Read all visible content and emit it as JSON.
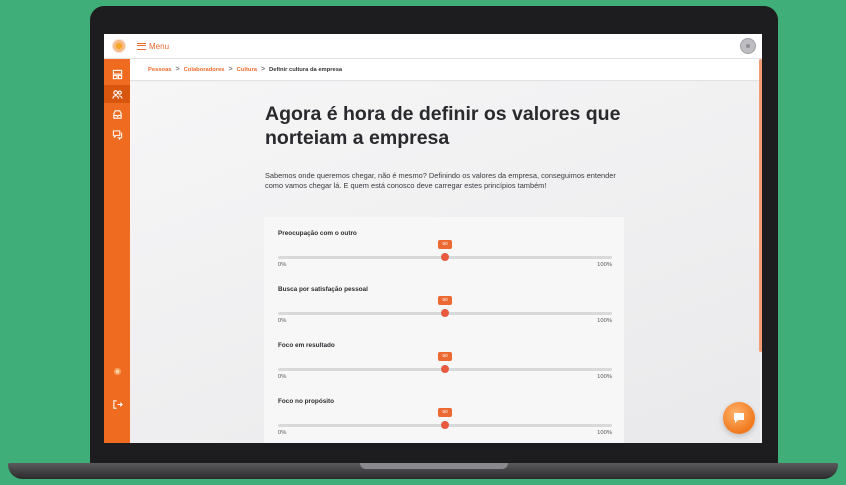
{
  "app": {
    "menu_label": "Menu"
  },
  "breadcrumb": {
    "items": [
      "Pessoas",
      "Colaboradores",
      "Cultura"
    ],
    "current": "Definir cultura da empresa",
    "separator": ">"
  },
  "page": {
    "heading": "Agora é hora de definir os valores que norteiam a empresa",
    "intro": "Sabemos onde queremos chegar, não é mesmo? Definindo os valores da empresa, conseguimos entender como vamos chegar lá. E quem está conosco deve carregar estes princípios também!"
  },
  "sliders": [
    {
      "label": "Preocupação com o outro",
      "value": 50,
      "min_label": "0%",
      "max_label": "100%"
    },
    {
      "label": "Busca por satisfação pessoal",
      "value": 50,
      "min_label": "0%",
      "max_label": "100%"
    },
    {
      "label": "Foco em resultado",
      "value": 50,
      "min_label": "0%",
      "max_label": "100%"
    },
    {
      "label": "Foco no propósito",
      "value": 50,
      "min_label": "0%",
      "max_label": "100%"
    }
  ],
  "sidebar": {
    "icons": [
      "dashboard-icon",
      "people-icon",
      "inbox-icon",
      "chat-icon",
      "sun-icon",
      "logout-icon"
    ],
    "active_index": 1
  },
  "colors": {
    "accent": "#ef6a2e",
    "sidebar": "#ef6b1f",
    "background": "#3fae78"
  }
}
